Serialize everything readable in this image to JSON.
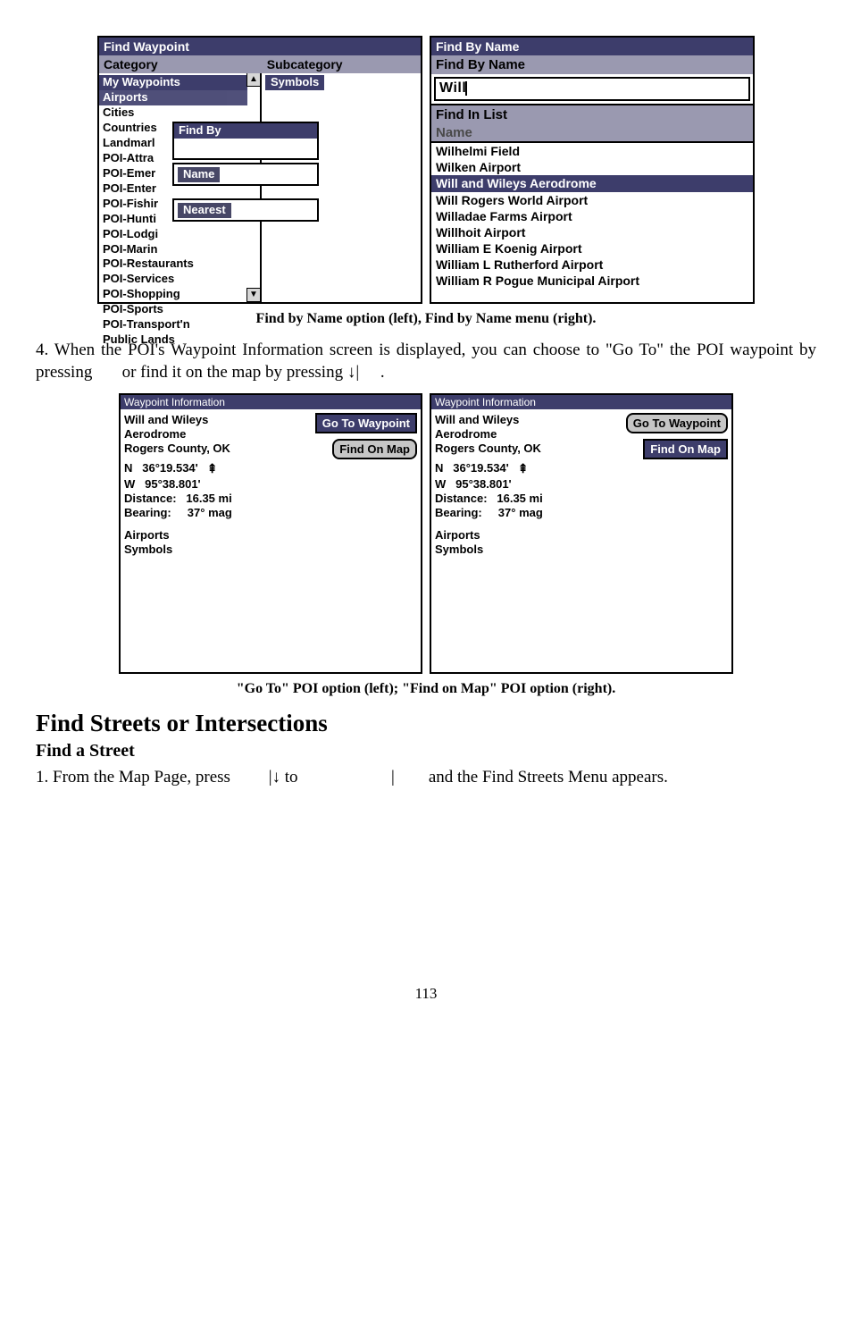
{
  "fig1": {
    "left": {
      "titlebar": "Find Waypoint",
      "col1": "Category",
      "col2": "Subcategory",
      "symbols": "Symbols",
      "items": [
        "My Waypoints",
        "Airports",
        "Cities",
        "Countries",
        "Landmarl",
        "POI-Attra",
        "POI-Emer",
        "POI-Enter",
        "POI-Fishir",
        "POI-Hunti",
        "POI-Lodgi",
        "POI-Marin",
        "POI-Restaurants",
        "POI-Services",
        "POI-Shopping",
        "POI-Sports",
        "POI-Transport'n",
        "Public Lands"
      ],
      "popup1_title": "Find By",
      "popup2_chip": "Name",
      "popup3_chip": "Nearest"
    },
    "right": {
      "titlebar": "Find By Name",
      "label1": "Find By Name",
      "input": "Will",
      "label2": "Find In List",
      "name_hdr": "Name",
      "results": [
        "Wilhelmi Field",
        "Wilken Airport",
        "Will and Wileys Aerodrome",
        "Will Rogers World Airport",
        "Willadae Farms Airport",
        "Willhoit Airport",
        "William E Koenig Airport",
        "William L Rutherford Airport",
        "William R Pogue Municipal Airport"
      ]
    },
    "caption": "Find by Name option (left), Find by Name menu (right)."
  },
  "para1": "4. When the POI's Waypoint Information screen is displayed, you can choose to \"Go To\" the POI waypoint by pressing       or find it on the map by pressing ↓|     .",
  "fig2": {
    "title": "Waypoint Information",
    "name": "Will and Wileys",
    "sub": "Aerodrome",
    "county": "Rogers County, OK",
    "lat_lbl": "N",
    "lat": "36°19.534'",
    "lon_lbl": "W",
    "lon": "95°38.801'",
    "dist_lbl": "Distance:",
    "dist": "16.35 mi",
    "brg_lbl": "Bearing:",
    "brg": "37° mag",
    "cat1": "Airports",
    "cat2": "Symbols",
    "btn_go": "Go To Waypoint",
    "btn_map": "Find On Map",
    "caption": "\"Go To\" POI option (left); \"Find on Map\" POI option (right)."
  },
  "h2": "Find Streets or Intersections",
  "h3": "Find a Street",
  "para2": "1. From the Map Page, press         |↓ to                      |        and the Find Streets Menu appears.",
  "pagenum": "113"
}
